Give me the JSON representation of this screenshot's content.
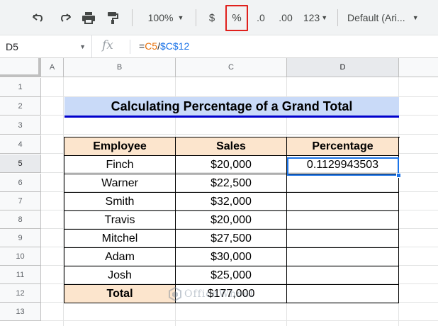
{
  "toolbar": {
    "zoom": "100%",
    "currency": "$",
    "percent": "%",
    "dec_decrease": ".0",
    "dec_increase": ".00",
    "more_formats": "123",
    "font": "Default (Ari..."
  },
  "formula_bar": {
    "cell_ref": "D5",
    "fx": "fx",
    "formula_eq": "=",
    "formula_ref1": "C5",
    "formula_op": "/",
    "formula_ref2": "$C$12"
  },
  "columns": [
    "A",
    "B",
    "C",
    "D"
  ],
  "rows": [
    "1",
    "2",
    "3",
    "4",
    "5",
    "6",
    "7",
    "8",
    "9",
    "10",
    "11",
    "12",
    "13"
  ],
  "active_cell": "D5",
  "sheet": {
    "title": "Calculating Percentage of a Grand Total",
    "headers": [
      "Employee",
      "Sales",
      "Percentage"
    ],
    "rows": [
      {
        "employee": "Finch",
        "sales": "$20,000",
        "percentage": "0.1129943503"
      },
      {
        "employee": "Warner",
        "sales": "$22,500",
        "percentage": ""
      },
      {
        "employee": "Smith",
        "sales": "$32,000",
        "percentage": ""
      },
      {
        "employee": "Travis",
        "sales": "$20,000",
        "percentage": ""
      },
      {
        "employee": "Mitchel",
        "sales": "$27,500",
        "percentage": ""
      },
      {
        "employee": "Adam",
        "sales": "$30,000",
        "percentage": ""
      },
      {
        "employee": "Josh",
        "sales": "$25,000",
        "percentage": ""
      }
    ],
    "total_label": "Total",
    "total_sales": "$177,000"
  },
  "watermark": "OfficeWheel",
  "colors": {
    "title_fill": "#c9daf8",
    "title_underline": "#0000cc",
    "header_fill": "#fce5cd",
    "selection": "#1a73e8",
    "highlight_box": "#e0201c"
  }
}
